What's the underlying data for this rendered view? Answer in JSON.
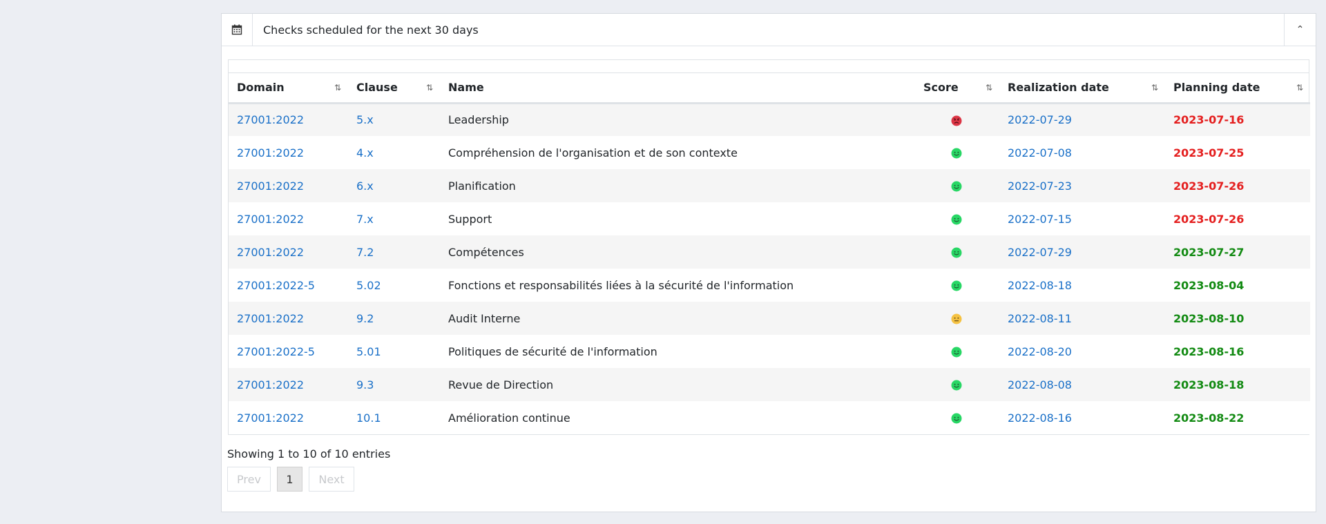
{
  "panel": {
    "title": "Checks scheduled for the next 30 days",
    "icon": "calendar-icon",
    "collapse_icon": "chevron-up-icon",
    "collapse_glyph": "⌃"
  },
  "table": {
    "columns": [
      "Domain",
      "Clause",
      "Name",
      "Score",
      "Realization date",
      "Planning date"
    ],
    "sort_glyph": "⇅",
    "rows": [
      {
        "domain": "27001:2022",
        "clause": "5.x",
        "name": "Leadership",
        "score": "angry",
        "realization": "2022-07-29",
        "planning": "2023-07-16",
        "planning_status": "late"
      },
      {
        "domain": "27001:2022",
        "clause": "4.x",
        "name": "Compréhension de l'organisation et de son contexte",
        "score": "happy",
        "realization": "2022-07-08",
        "planning": "2023-07-25",
        "planning_status": "late"
      },
      {
        "domain": "27001:2022",
        "clause": "6.x",
        "name": "Planification",
        "score": "happy",
        "realization": "2022-07-23",
        "planning": "2023-07-26",
        "planning_status": "late"
      },
      {
        "domain": "27001:2022",
        "clause": "7.x",
        "name": "Support",
        "score": "happy",
        "realization": "2022-07-15",
        "planning": "2023-07-26",
        "planning_status": "late"
      },
      {
        "domain": "27001:2022",
        "clause": "7.2",
        "name": "Compétences",
        "score": "happy",
        "realization": "2022-07-29",
        "planning": "2023-07-27",
        "planning_status": "ok"
      },
      {
        "domain": "27001:2022-5",
        "clause": "5.02",
        "name": "Fonctions et responsabilités liées à la sécurité de l'information",
        "score": "happy",
        "realization": "2022-08-18",
        "planning": "2023-08-04",
        "planning_status": "ok"
      },
      {
        "domain": "27001:2022",
        "clause": "9.2",
        "name": "Audit Interne",
        "score": "neutral",
        "realization": "2022-08-11",
        "planning": "2023-08-10",
        "planning_status": "ok"
      },
      {
        "domain": "27001:2022-5",
        "clause": "5.01",
        "name": "Politiques de sécurité de l'information",
        "score": "happy",
        "realization": "2022-08-20",
        "planning": "2023-08-16",
        "planning_status": "ok"
      },
      {
        "domain": "27001:2022",
        "clause": "9.3",
        "name": "Revue de Direction",
        "score": "happy",
        "realization": "2022-08-08",
        "planning": "2023-08-18",
        "planning_status": "ok"
      },
      {
        "domain": "27001:2022",
        "clause": "10.1",
        "name": "Amélioration continue",
        "score": "happy",
        "realization": "2022-08-16",
        "planning": "2023-08-22",
        "planning_status": "ok"
      }
    ]
  },
  "score_colors": {
    "angry": "#dc3545",
    "happy": "#28d765",
    "neutral": "#f5c242"
  },
  "footer": {
    "info": "Showing 1 to 10 of 10 entries",
    "prev": "Prev",
    "page": "1",
    "next": "Next"
  }
}
